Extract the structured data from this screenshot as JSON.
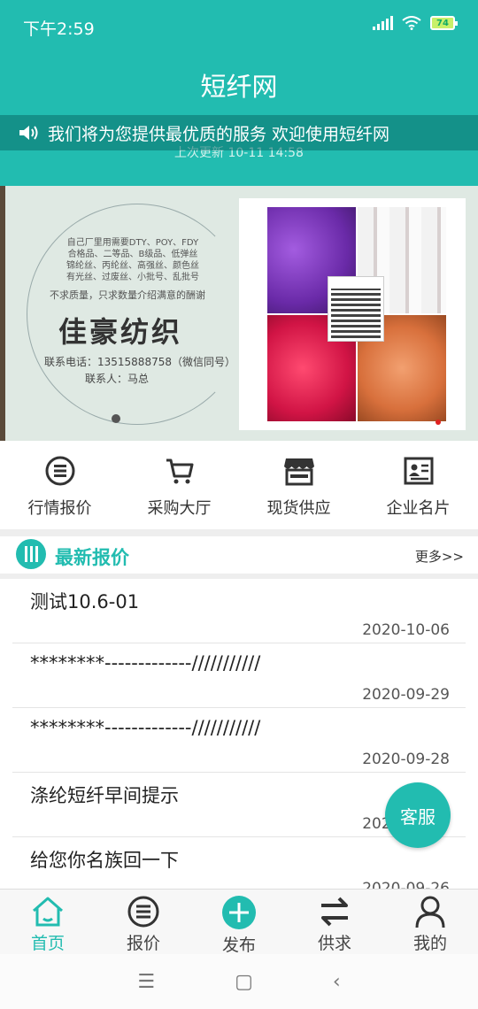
{
  "status_bar": {
    "time": "下午2:59",
    "battery": "74"
  },
  "app": {
    "title": "短纤网"
  },
  "notice": {
    "text": "我们将为您提供最优质的服务 欢迎使用短纤网",
    "update_time": "上次更新 10-11 14:58"
  },
  "banner": {
    "lines": [
      "自己厂里用需要DTY、POY、FDY",
      "合格品、二等品、B级品、低弹丝",
      "锦纶丝、丙纶丝、高强丝、颜色丝",
      "有光丝、过废丝、小批号、乱批号"
    ],
    "tagline": "不求质量，只求数量介绍满意的酬谢",
    "company": "佳豪纺织",
    "phone": "联系电话：13515888758（微信同号）",
    "contact": "联系人：马总"
  },
  "quick_nav": [
    {
      "label": "行情报价",
      "icon": "list-icon"
    },
    {
      "label": "采购大厅",
      "icon": "cart-icon"
    },
    {
      "label": "现货供应",
      "icon": "store-icon"
    },
    {
      "label": "企业名片",
      "icon": "id-card-icon"
    }
  ],
  "section": {
    "title": "最新报价",
    "more": "更多>>"
  },
  "quotes": [
    {
      "title": "测试10.6-01",
      "date": "2020-10-06"
    },
    {
      "title": "********-------------///////////",
      "date": "2020-09-29"
    },
    {
      "title": "********-------------///////////",
      "date": "2020-09-28"
    },
    {
      "title": "涤纶短纤早间提示",
      "date": "2020-09-27"
    },
    {
      "title": "给您你名族回一下",
      "date": "2020-09-26"
    }
  ],
  "service_button": "客服",
  "tabbar": [
    {
      "label": "首页",
      "icon": "home-icon"
    },
    {
      "label": "报价",
      "icon": "list-icon"
    },
    {
      "label": "发布",
      "icon": "plus-icon"
    },
    {
      "label": "供求",
      "icon": "swap-icon"
    },
    {
      "label": "我的",
      "icon": "user-icon"
    }
  ],
  "colors": {
    "accent": "#22bcb0"
  }
}
